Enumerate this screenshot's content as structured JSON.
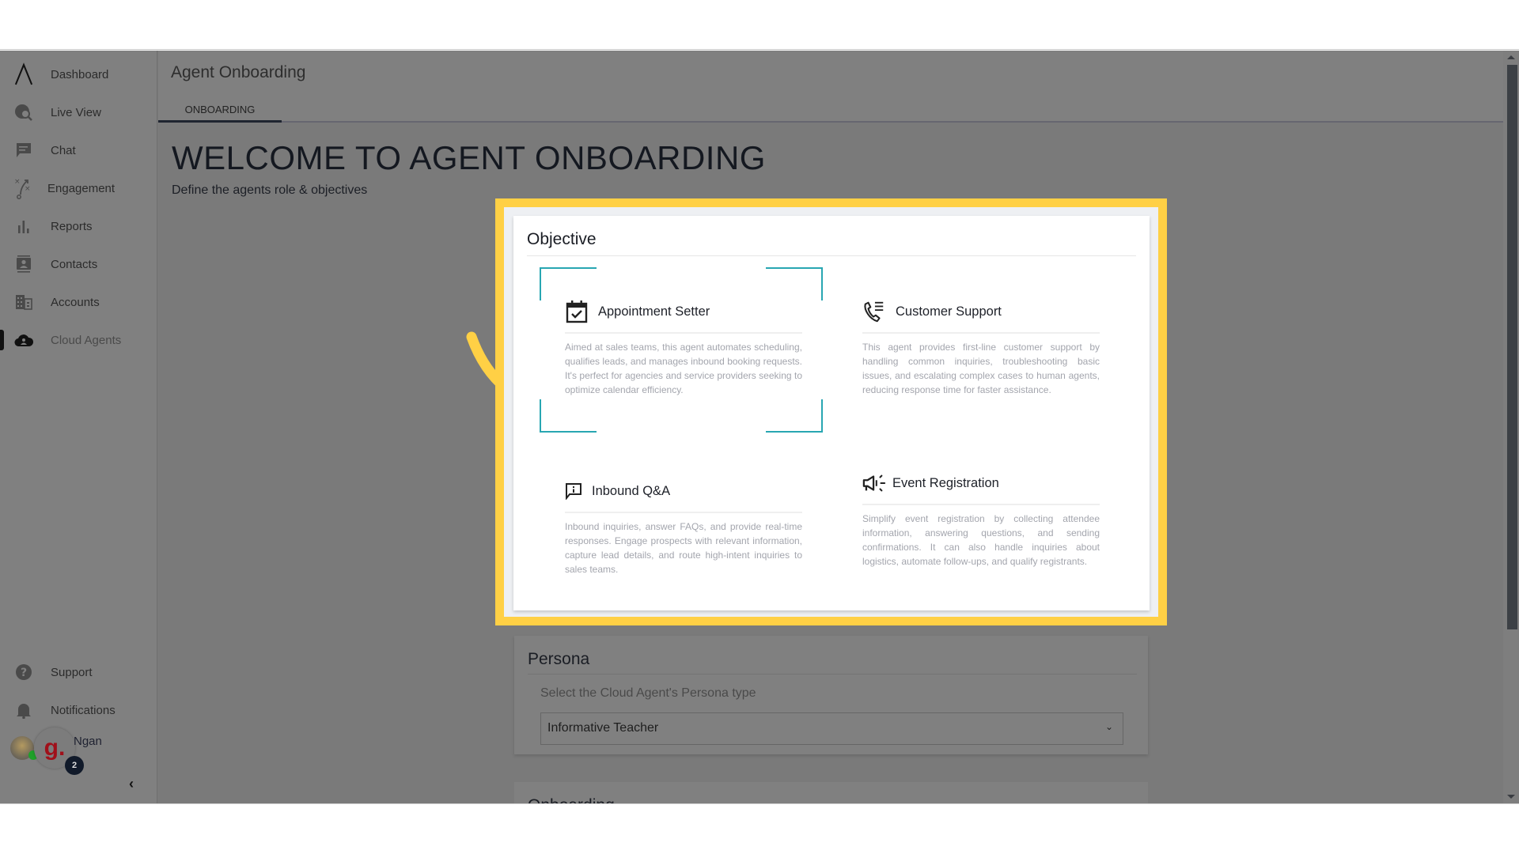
{
  "sidebar": {
    "items": [
      {
        "label": "Dashboard",
        "icon": "logo-icon"
      },
      {
        "label": "Live View",
        "icon": "live-view-icon"
      },
      {
        "label": "Chat",
        "icon": "chat-icon"
      },
      {
        "label": "Engagement",
        "icon": "engagement-icon"
      },
      {
        "label": "Reports",
        "icon": "bar-chart-icon"
      },
      {
        "label": "Contacts",
        "icon": "contacts-icon"
      },
      {
        "label": "Accounts",
        "icon": "building-icon"
      },
      {
        "label": "Cloud Agents",
        "icon": "cloud-agent-icon",
        "active": true
      }
    ],
    "bottom_items": [
      {
        "label": "Support",
        "icon": "help-icon"
      },
      {
        "label": "Notifications",
        "icon": "bell-icon"
      }
    ],
    "user": {
      "name": "Ngan",
      "logo_glyph": "g.",
      "badge_count": "2",
      "status": "online"
    },
    "collapse_glyph": "‹"
  },
  "header": {
    "title": "Agent Onboarding",
    "tabs": [
      {
        "label": "ONBOARDING",
        "active": true
      }
    ]
  },
  "welcome": {
    "heading": "WELCOME TO AGENT ONBOARDING",
    "subtitle": "Define the agents role & objectives"
  },
  "objective": {
    "title": "Objective",
    "highlight_color": "#ffd045",
    "selection_color": "#28a6b2",
    "options": [
      {
        "name": "Appointment Setter",
        "icon": "calendar-check-icon",
        "selected": true,
        "description": "Aimed at sales teams, this agent automates scheduling, qualifies leads, and manages inbound booking requests. It's perfect for agencies and service providers seeking to optimize calendar efficiency."
      },
      {
        "name": "Customer Support",
        "icon": "phone-list-icon",
        "selected": false,
        "description": "This agent provides first-line customer support by handling common inquiries, troubleshooting basic issues, and escalating complex cases to human agents, reducing response time for faster assistance."
      },
      {
        "name": "Inbound Q&A",
        "icon": "info-message-icon",
        "selected": false,
        "description": "Inbound inquiries, answer FAQs, and provide real-time responses. Engage prospects with relevant information, capture lead details, and route high-intent inquiries to sales teams."
      },
      {
        "name": "Event Registration",
        "icon": "megaphone-icon",
        "selected": false,
        "description": "Simplify event registration by collecting attendee information, answering questions, and sending confirmations. It can also handle inquiries about logistics, automate follow-ups, and qualify registrants."
      }
    ]
  },
  "persona": {
    "title": "Persona",
    "label": "Select the Cloud Agent's Persona type",
    "selected": "Informative Teacher"
  },
  "onboarding_section": {
    "title": "Onboarding"
  }
}
